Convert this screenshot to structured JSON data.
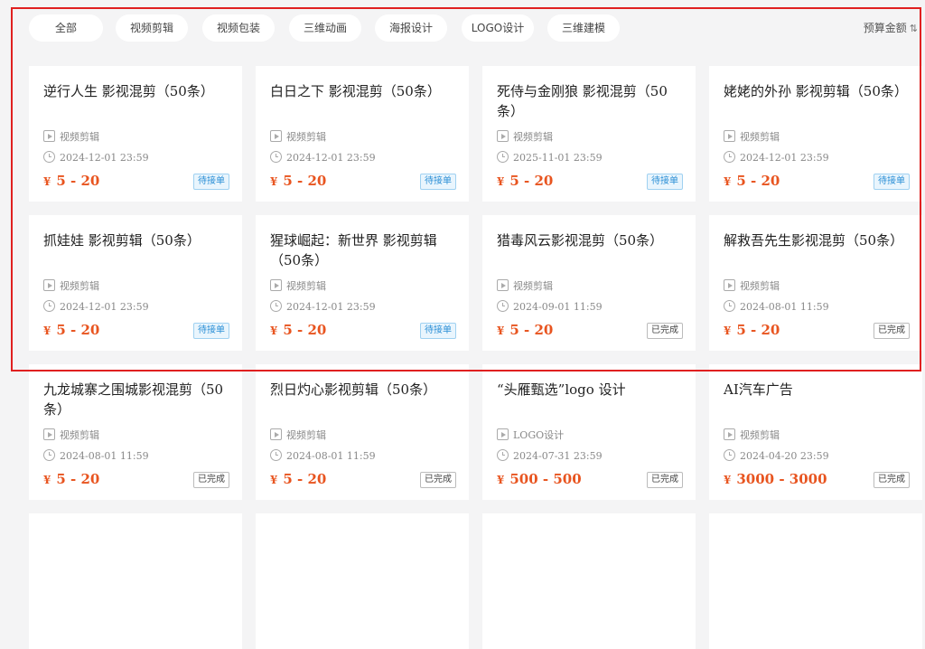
{
  "filters": {
    "tabs": [
      {
        "label": "全部",
        "active": true
      },
      {
        "label": "视频剪辑",
        "active": false
      },
      {
        "label": "视频包装",
        "active": false
      },
      {
        "label": "三维动画",
        "active": false
      },
      {
        "label": "海报设计",
        "active": false
      },
      {
        "label": "LOGO设计",
        "active": false
      },
      {
        "label": "三维建模",
        "active": false
      }
    ],
    "sort_label": "预算金额",
    "sort_icon": "sort-arrows-icon"
  },
  "cards": [
    {
      "title": "逆行人生 影视混剪（50条）",
      "category": "视频剪辑",
      "date": "2024-12-01 23:59",
      "currency": "¥",
      "price": "5 - 20",
      "status": "待接单",
      "status_type": "pending"
    },
    {
      "title": "白日之下 影视混剪（50条）",
      "category": "视频剪辑",
      "date": "2024-12-01 23:59",
      "currency": "¥",
      "price": "5 - 20",
      "status": "待接单",
      "status_type": "pending"
    },
    {
      "title": "死侍与金刚狼 影视混剪（50条）",
      "category": "视频剪辑",
      "date": "2025-11-01 23:59",
      "currency": "¥",
      "price": "5 - 20",
      "status": "待接单",
      "status_type": "pending"
    },
    {
      "title": "姥姥的外孙 影视剪辑（50条）",
      "category": "视频剪辑",
      "date": "2024-12-01 23:59",
      "currency": "¥",
      "price": "5 - 20",
      "status": "待接单",
      "status_type": "pending"
    },
    {
      "title": "抓娃娃 影视剪辑（50条）",
      "category": "视频剪辑",
      "date": "2024-12-01 23:59",
      "currency": "¥",
      "price": "5 - 20",
      "status": "待接单",
      "status_type": "pending"
    },
    {
      "title": "猩球崛起：新世界 影视剪辑（50条）",
      "category": "视频剪辑",
      "date": "2024-12-01 23:59",
      "currency": "¥",
      "price": "5 - 20",
      "status": "待接单",
      "status_type": "pending"
    },
    {
      "title": "猎毒风云影视混剪（50条）",
      "category": "视频剪辑",
      "date": "2024-09-01 11:59",
      "currency": "¥",
      "price": "5 - 20",
      "status": "已完成",
      "status_type": "done"
    },
    {
      "title": "解救吾先生影视混剪（50条）",
      "category": "视频剪辑",
      "date": "2024-08-01 11:59",
      "currency": "¥",
      "price": "5 - 20",
      "status": "已完成",
      "status_type": "done"
    },
    {
      "title": "九龙城寨之围城影视混剪（50条）",
      "category": "视频剪辑",
      "date": "2024-08-01 11:59",
      "currency": "¥",
      "price": "5 - 20",
      "status": "已完成",
      "status_type": "done"
    },
    {
      "title": "烈日灼心影视剪辑（50条）",
      "category": "视频剪辑",
      "date": "2024-08-01 11:59",
      "currency": "¥",
      "price": "5 - 20",
      "status": "已完成",
      "status_type": "done"
    },
    {
      "title": "“头雁甄选”logo 设计",
      "category": "LOGO设计",
      "date": "2024-07-31 23:59",
      "currency": "¥",
      "price": "500 - 500",
      "status": "已完成",
      "status_type": "done"
    },
    {
      "title": "AI汽车广告",
      "category": "视频剪辑",
      "date": "2024-04-20 23:59",
      "currency": "¥",
      "price": "3000 - 3000",
      "status": "已完成",
      "status_type": "done"
    }
  ],
  "colors": {
    "accent": "#f26a2e",
    "price": "#e8541f",
    "pending_badge": "#2b8fd6",
    "highlight": "#e02020"
  }
}
